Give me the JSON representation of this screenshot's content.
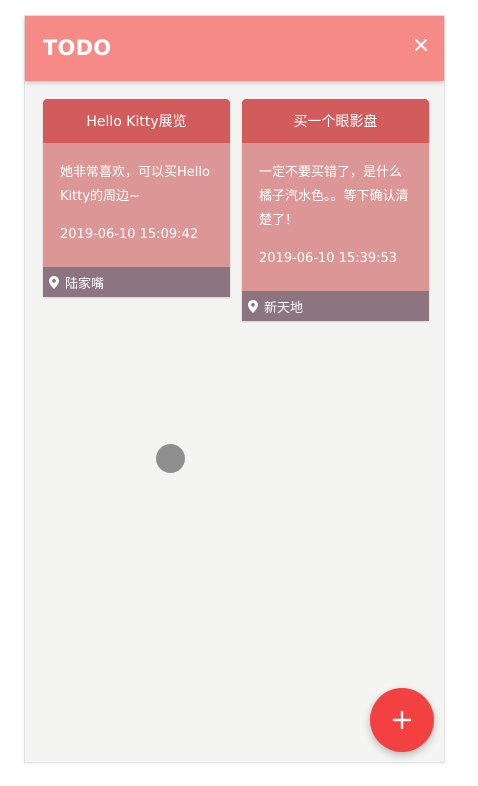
{
  "app": {
    "title": "TODO"
  },
  "icons": {
    "close": "close-icon",
    "location": "location-pin-icon",
    "add": "plus-icon"
  },
  "colors": {
    "header": "#f58a87",
    "card_header": "#d15c5b",
    "card_body": "#dc9696",
    "card_footer": "#8c7580",
    "fab": "#f34141",
    "background": "#f4f4f2"
  },
  "notes": [
    {
      "title": "Hello Kitty展览",
      "content": "她非常喜欢，可以买Hello Kitty的周边~",
      "date": "2019-06-10 15:09:42",
      "location": "陆家嘴"
    },
    {
      "title": "买一个眼影盘",
      "content": "一定不要买错了，是什么橘子汽水色。。等下确认清楚了！",
      "date": "2019-06-10 15:39:53",
      "location": "新天地"
    }
  ]
}
